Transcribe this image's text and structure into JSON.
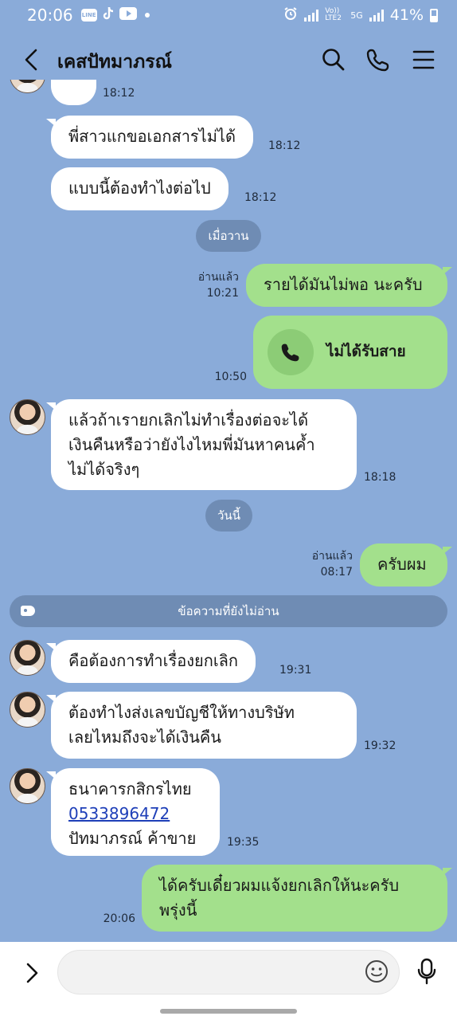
{
  "status_bar": {
    "time": "20:06",
    "network_label": "Vo)) LTE2",
    "network_type": "5G",
    "battery": "41%"
  },
  "header": {
    "title": "เคสปัทมาภรณ์",
    "icons": [
      "back-chevron-icon",
      "search-icon",
      "phone-icon",
      "menu-icon"
    ]
  },
  "messages": {
    "m0_time": "18:12",
    "m1_text": "พี่สาวแกขอเอกสารไม่ได้",
    "m1_time": "18:12",
    "m2_text": "แบบนี้ต้องทำไงต่อไป",
    "m2_time": "18:12",
    "date_yesterday": "เมื่อวาน",
    "m3_read": "อ่านแล้ว",
    "m3_time": "10:21",
    "m3_text": "รายได้มันไม่พอ นะครับ",
    "call_label": "ไม่ได้รับสาย",
    "call_time": "10:50",
    "m4_lines": [
      "แล้วถ้าเรายกเลิกไม่ทำเรื่องต่อจะได้",
      "เงินคืนหรือว่ายังไงไหมพี่มันหาคนค้ำ",
      "ไม่ได้จริงๆ"
    ],
    "m4_time": "18:18",
    "date_today": "วันนี้",
    "m5_read": "อ่านแล้ว",
    "m5_time": "08:17",
    "m5_text": "ครับผม",
    "unread_label": "ข้อความที่ยังไม่อ่าน",
    "m6_text": "คือต้องการทำเรื่องยกเลิก",
    "m6_time": "19:31",
    "m7_lines": [
      "ต้องทำไงส่งเลขบัญชีให้ทางบริษัท",
      "เลยไหมถึงจะได้เงินคืน"
    ],
    "m7_time": "19:32",
    "m8_line1": "ธนาคารกสิกรไทย",
    "m8_account": "0533896472",
    "m8_line3": "ปัทมาภรณ์ ค้าขาย",
    "m8_time": "19:35",
    "m9_lines": [
      "ได้ครับเดี๋ยวผมแจ้งยกเลิกให้นะครับ",
      "พรุ่งนี้"
    ],
    "m9_time": "20:06"
  },
  "input_bar": {
    "value": "",
    "icons": [
      "expand-chevron-icon",
      "emoji-icon",
      "microphone-icon"
    ]
  },
  "colors": {
    "chat_background": "#8aabd9",
    "incoming_bubble": "#ffffff",
    "outgoing_bubble": "#a3e08c",
    "date_pill": "#6f8cb4"
  }
}
